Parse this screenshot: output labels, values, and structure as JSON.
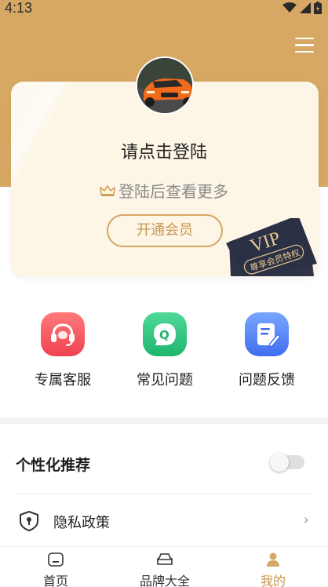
{
  "status_bar": {
    "time": "4:13"
  },
  "card": {
    "title": "请点击登陆",
    "subtitle": "登陆后查看更多",
    "open_vip_label": "开通会员",
    "vip_badge": {
      "title": "VIP",
      "caption": "尊享会员特权"
    }
  },
  "quick_actions": [
    {
      "label": "专属客服",
      "icon": "headset-icon",
      "color": "#f2545b"
    },
    {
      "label": "常见问题",
      "icon": "chat-q-icon",
      "color": "#2ec27e"
    },
    {
      "label": "问题反馈",
      "icon": "feedback-edit-icon",
      "color": "#4a7cf7"
    }
  ],
  "settings": {
    "recommend_label": "个性化推荐",
    "recommend_enabled": false,
    "privacy_label": "隐私政策",
    "arrow": "›"
  },
  "tabbar": [
    {
      "label": "首页",
      "icon": "home-icon",
      "active": false
    },
    {
      "label": "品牌大全",
      "icon": "car-icon",
      "active": false
    },
    {
      "label": "我的",
      "icon": "user-icon",
      "active": true
    }
  ],
  "colors": {
    "accent": "#d6a863",
    "accent_text": "#c8954e",
    "card_bg": "#fdf5e6"
  }
}
